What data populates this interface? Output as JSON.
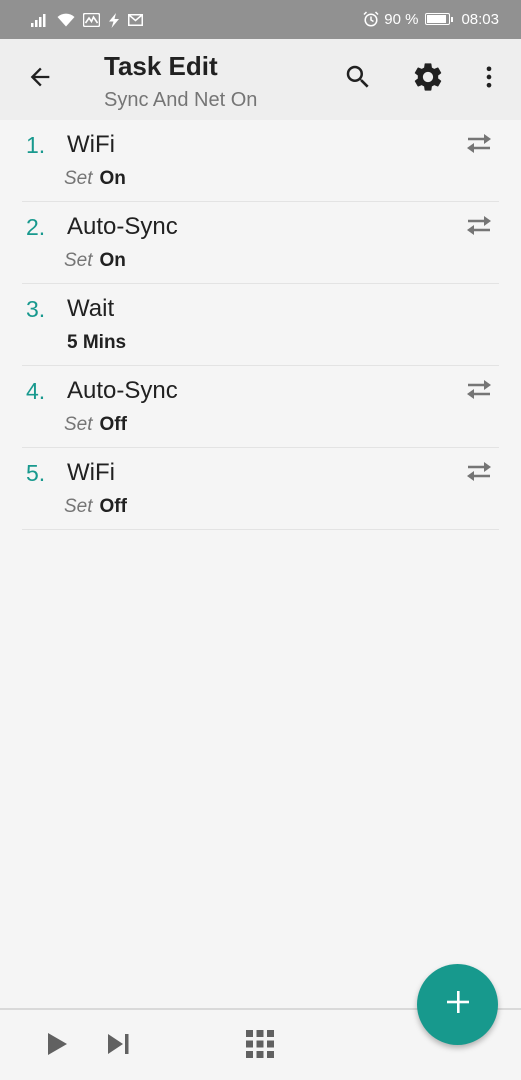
{
  "status_bar": {
    "battery_text": "90 %",
    "battery_level": 0.9,
    "time": "08:03",
    "icons": [
      "signal-icon",
      "wifi-icon",
      "activity-icon",
      "flash-icon",
      "mail-icon",
      "alarm-icon",
      "battery-icon"
    ]
  },
  "app_bar": {
    "title": "Task Edit",
    "subtitle": "Sync And Net On",
    "icons": [
      "back-arrow-icon",
      "search-icon",
      "gear-icon",
      "more-vert-icon"
    ]
  },
  "actions": [
    {
      "number": "1.",
      "name": "WiFi",
      "detail_key": "Set",
      "detail_value": "On",
      "has_swap_icon": true
    },
    {
      "number": "2.",
      "name": "Auto-Sync",
      "detail_key": "Set",
      "detail_value": "On",
      "has_swap_icon": true
    },
    {
      "number": "3.",
      "name": "Wait",
      "detail_key": "",
      "detail_value": "5 Mins",
      "has_swap_icon": false
    },
    {
      "number": "4.",
      "name": "Auto-Sync",
      "detail_key": "Set",
      "detail_value": "Off",
      "has_swap_icon": true
    },
    {
      "number": "5.",
      "name": "WiFi",
      "detail_key": "Set",
      "detail_value": "Off",
      "has_swap_icon": true
    }
  ],
  "bottom_bar": {
    "icons": [
      "play-icon",
      "step-forward-icon",
      "grid-icon"
    ]
  },
  "fab": {
    "icon": "plus-icon"
  },
  "colors": {
    "accent": "#18998e",
    "status_bar": "#919191",
    "app_bar": "#eeeeee",
    "background": "#f5f5f5"
  }
}
